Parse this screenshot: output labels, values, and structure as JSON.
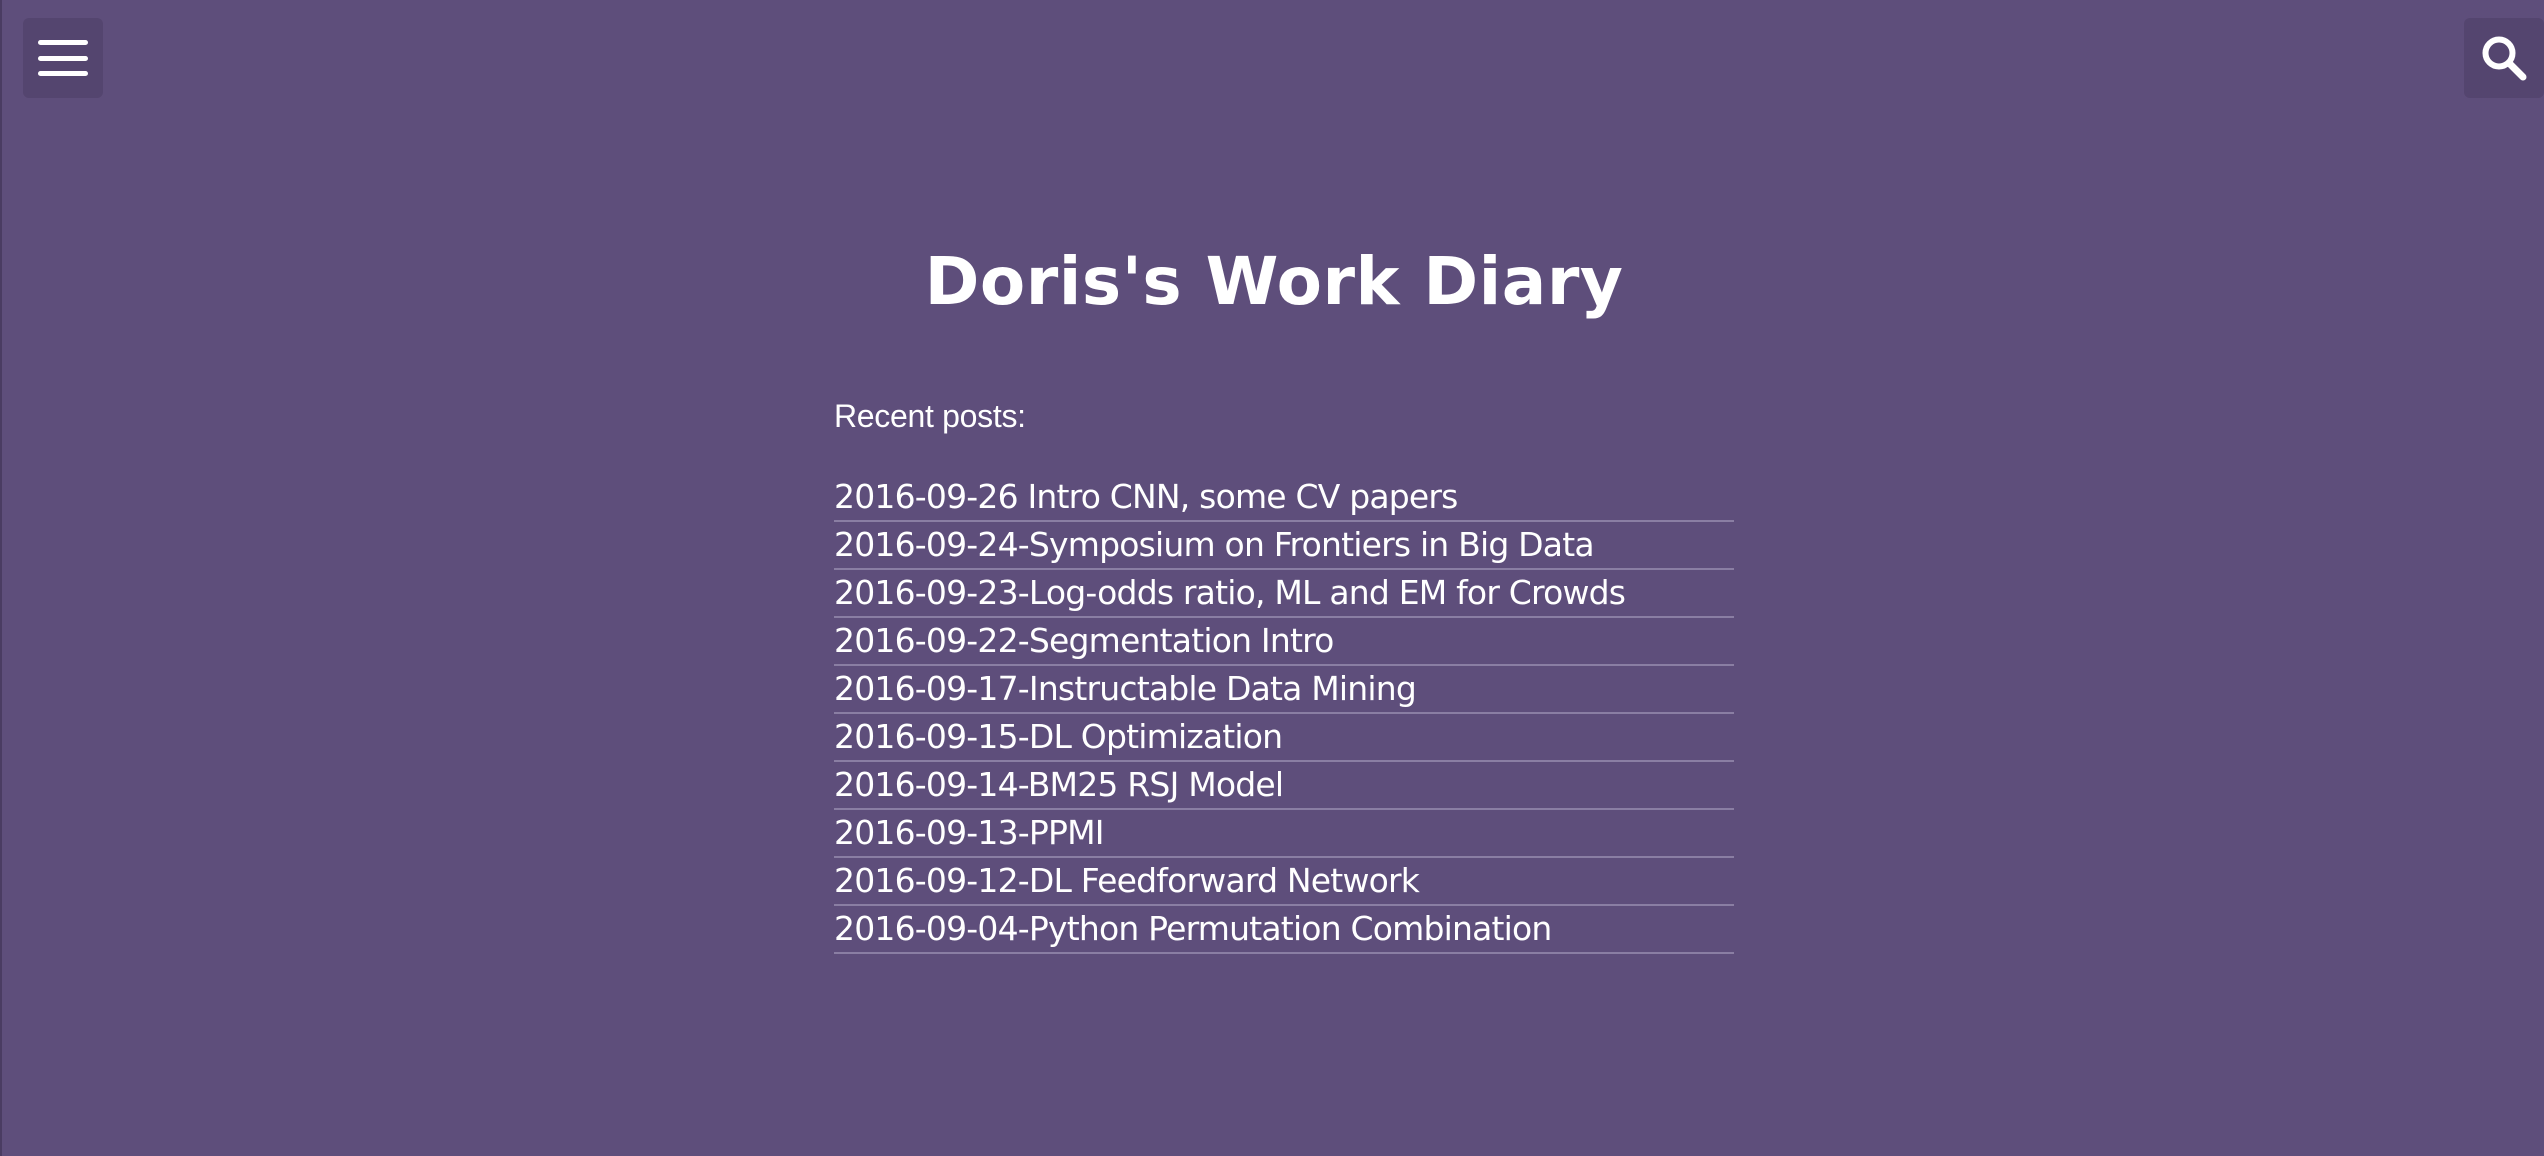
{
  "header": {
    "menu_icon": "hamburger-menu-icon",
    "search_icon": "search-icon"
  },
  "site": {
    "title": "Doris's Work Diary"
  },
  "recent": {
    "heading": "Recent posts:",
    "posts": [
      {
        "label": "2016-09-26 Intro CNN, some CV papers"
      },
      {
        "label": "2016-09-24-Symposium on Frontiers in Big Data"
      },
      {
        "label": "2016-09-23-Log-odds ratio, ML and EM for Crowds"
      },
      {
        "label": "2016-09-22-Segmentation Intro"
      },
      {
        "label": "2016-09-17-Instructable Data Mining"
      },
      {
        "label": "2016-09-15-DL Optimization"
      },
      {
        "label": "2016-09-14-BM25 RSJ Model"
      },
      {
        "label": "2016-09-13-PPMI"
      },
      {
        "label": "2016-09-12-DL Feedforward Network"
      },
      {
        "label": "2016-09-04-Python Permutation Combination"
      }
    ]
  },
  "colors": {
    "background": "#5e4e7b",
    "button_background": "#54456f",
    "divider": "#8a7ea3",
    "text": "#ffffff"
  }
}
